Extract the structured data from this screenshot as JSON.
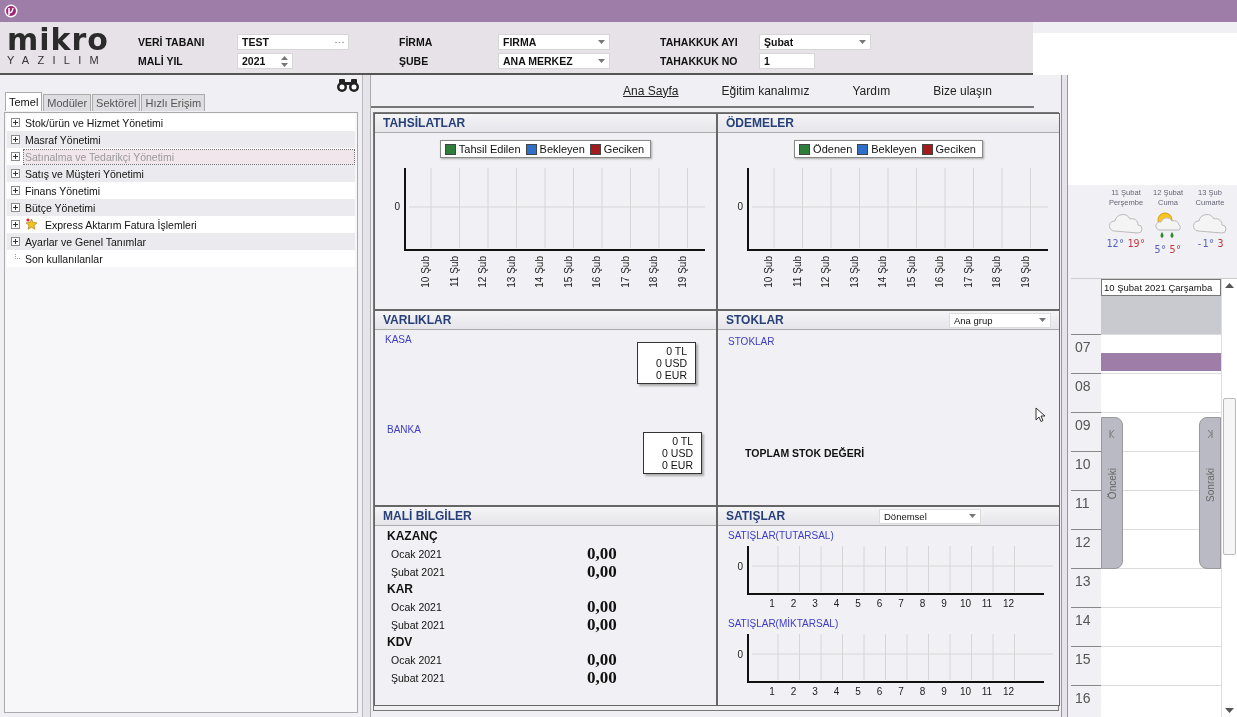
{
  "logo": {
    "name": "mikro",
    "tagline": "YAZILIM"
  },
  "header": {
    "groups": [
      {
        "fields": [
          {
            "label": "VERİ TABANI",
            "value": "TEST",
            "kind": "browse"
          },
          {
            "label": "MALİ YIL",
            "value": "2021",
            "kind": "spin"
          }
        ]
      },
      {
        "fields": [
          {
            "label": "FİRMA",
            "value": "FIRMA",
            "kind": "dropdown"
          },
          {
            "label": "ŞUBE",
            "value": "ANA MERKEZ",
            "kind": "dropdown"
          }
        ]
      },
      {
        "fields": [
          {
            "label": "TAHAKKUK AYI",
            "value": "Şubat",
            "kind": "dropdown"
          },
          {
            "label": "TAHAKKUK NO",
            "value": "1",
            "kind": "text"
          }
        ]
      }
    ]
  },
  "sidebar": {
    "tabs": [
      {
        "label": "Temel",
        "selected": true
      },
      {
        "label": "Modüler",
        "selected": false
      },
      {
        "label": "Sektörel",
        "selected": false
      },
      {
        "label": "Hızlı Erişim",
        "selected": false
      }
    ],
    "items": [
      {
        "label": "Stok/ürün ve Hizmet Yönetimi",
        "expandable": true,
        "selected": false,
        "kind": "module"
      },
      {
        "label": "Masraf Yönetimi",
        "expandable": true,
        "selected": false,
        "kind": "module"
      },
      {
        "label": "Satınalma ve Tedarikçi Yönetimi",
        "expandable": true,
        "selected": true,
        "kind": "module"
      },
      {
        "label": "Satış ve Müşteri Yönetimi",
        "expandable": true,
        "selected": false,
        "kind": "module"
      },
      {
        "label": "Finans Yönetimi",
        "expandable": true,
        "selected": false,
        "kind": "module"
      },
      {
        "label": "Bütçe Yönetimi",
        "expandable": true,
        "selected": false,
        "kind": "module"
      },
      {
        "label": "Express Aktarım Fatura İşlemleri",
        "expandable": true,
        "selected": false,
        "kind": "favorite"
      },
      {
        "label": "Ayarlar ve Genel Tanımlar",
        "expandable": true,
        "selected": false,
        "kind": "module"
      },
      {
        "label": "Son kullanılanlar",
        "expandable": false,
        "selected": false,
        "kind": "module"
      }
    ]
  },
  "nav": [
    {
      "label": "Ana Sayfa",
      "selected": true
    },
    {
      "label": "Eğitim kanalımız",
      "selected": false
    },
    {
      "label": "Yardım",
      "selected": false
    },
    {
      "label": "Bize ulaşın",
      "selected": false
    }
  ],
  "tahsilatlar": {
    "title": "TAHSİLATLAR",
    "legend": [
      {
        "label": "Tahsil Edilen",
        "color": "#2e7d3a"
      },
      {
        "label": "Bekleyen",
        "color": "#2f6fc9"
      },
      {
        "label": "Geciken",
        "color": "#a31b1b"
      }
    ],
    "y_label": "0",
    "x_labels": [
      "10 Şub",
      "11 Şub",
      "12 Şub",
      "13 Şub",
      "14 Şub",
      "15 Şub",
      "16 Şub",
      "17 Şub",
      "18 Şub",
      "19 Şub"
    ]
  },
  "odemeler": {
    "title": "ÖDEMELER",
    "legend": [
      {
        "label": "Ödenen",
        "color": "#2e7d3a"
      },
      {
        "label": "Bekleyen",
        "color": "#2f6fc9"
      },
      {
        "label": "Geciken",
        "color": "#a31b1b"
      }
    ],
    "y_label": "0",
    "x_labels": [
      "10 Şub",
      "11 Şub",
      "12 Şub",
      "13 Şub",
      "14 Şub",
      "15 Şub",
      "16 Şub",
      "17 Şub",
      "18 Şub",
      "19 Şub"
    ]
  },
  "varliklar": {
    "title": "VARLIKLAR",
    "accounts": [
      {
        "label": "KASA",
        "amounts": [
          "0 TL",
          "0 USD",
          "0 EUR"
        ]
      },
      {
        "label": "BANKA",
        "amounts": [
          "0 TL",
          "0 USD",
          "0 EUR"
        ]
      }
    ]
  },
  "stoklar": {
    "title": "STOKLAR",
    "filter": "Ana grup",
    "label": "STOKLAR",
    "total_label": "TOPLAM STOK DEĞERİ"
  },
  "mali_bilgiler": {
    "title": "MALİ BİLGİLER",
    "groups": [
      {
        "title": "KAZANÇ",
        "rows": [
          {
            "period": "Ocak 2021",
            "value": "0,00"
          },
          {
            "period": "Şubat 2021",
            "value": "0,00"
          }
        ]
      },
      {
        "title": "KAR",
        "rows": [
          {
            "period": "Ocak 2021",
            "value": "0,00"
          },
          {
            "period": "Şubat 2021",
            "value": "0,00"
          }
        ]
      },
      {
        "title": "KDV",
        "rows": [
          {
            "period": "Ocak 2021",
            "value": "0,00"
          },
          {
            "period": "Şubat 2021",
            "value": "0,00"
          }
        ]
      }
    ]
  },
  "satislar": {
    "title": "SATIŞLAR",
    "filter": "Dönemsel",
    "charts": [
      {
        "title": "SATIŞLAR(TUTARSAL)",
        "y_label": "0",
        "x_labels": [
          "1",
          "2",
          "3",
          "4",
          "5",
          "6",
          "7",
          "8",
          "9",
          "10",
          "11",
          "12"
        ]
      },
      {
        "title": "SATIŞLAR(MİKTARSAL)",
        "y_label": "0",
        "x_labels": [
          "1",
          "2",
          "3",
          "4",
          "5",
          "6",
          "7",
          "8",
          "9",
          "10",
          "11",
          "12"
        ]
      }
    ]
  },
  "weather": [
    {
      "date": "11 Şubat",
      "day": "Perşembe",
      "kind": "cloudy",
      "low": "12°",
      "high": "19°"
    },
    {
      "date": "12 Şubat",
      "day": "Cuma",
      "kind": "sun_rain",
      "low": "5°",
      "high": "5°"
    },
    {
      "date": "13 Şub",
      "day": "Cumarte",
      "kind": "cloudy",
      "low": "-1°",
      "high": "3"
    }
  ],
  "calendar": {
    "date": "10 Şubat 2021 Çarşamba",
    "hours": [
      "07",
      "08",
      "09",
      "10",
      "11",
      "12",
      "13",
      "14",
      "15",
      "16"
    ],
    "prev": "Önceki",
    "next": "Sonraki"
  }
}
